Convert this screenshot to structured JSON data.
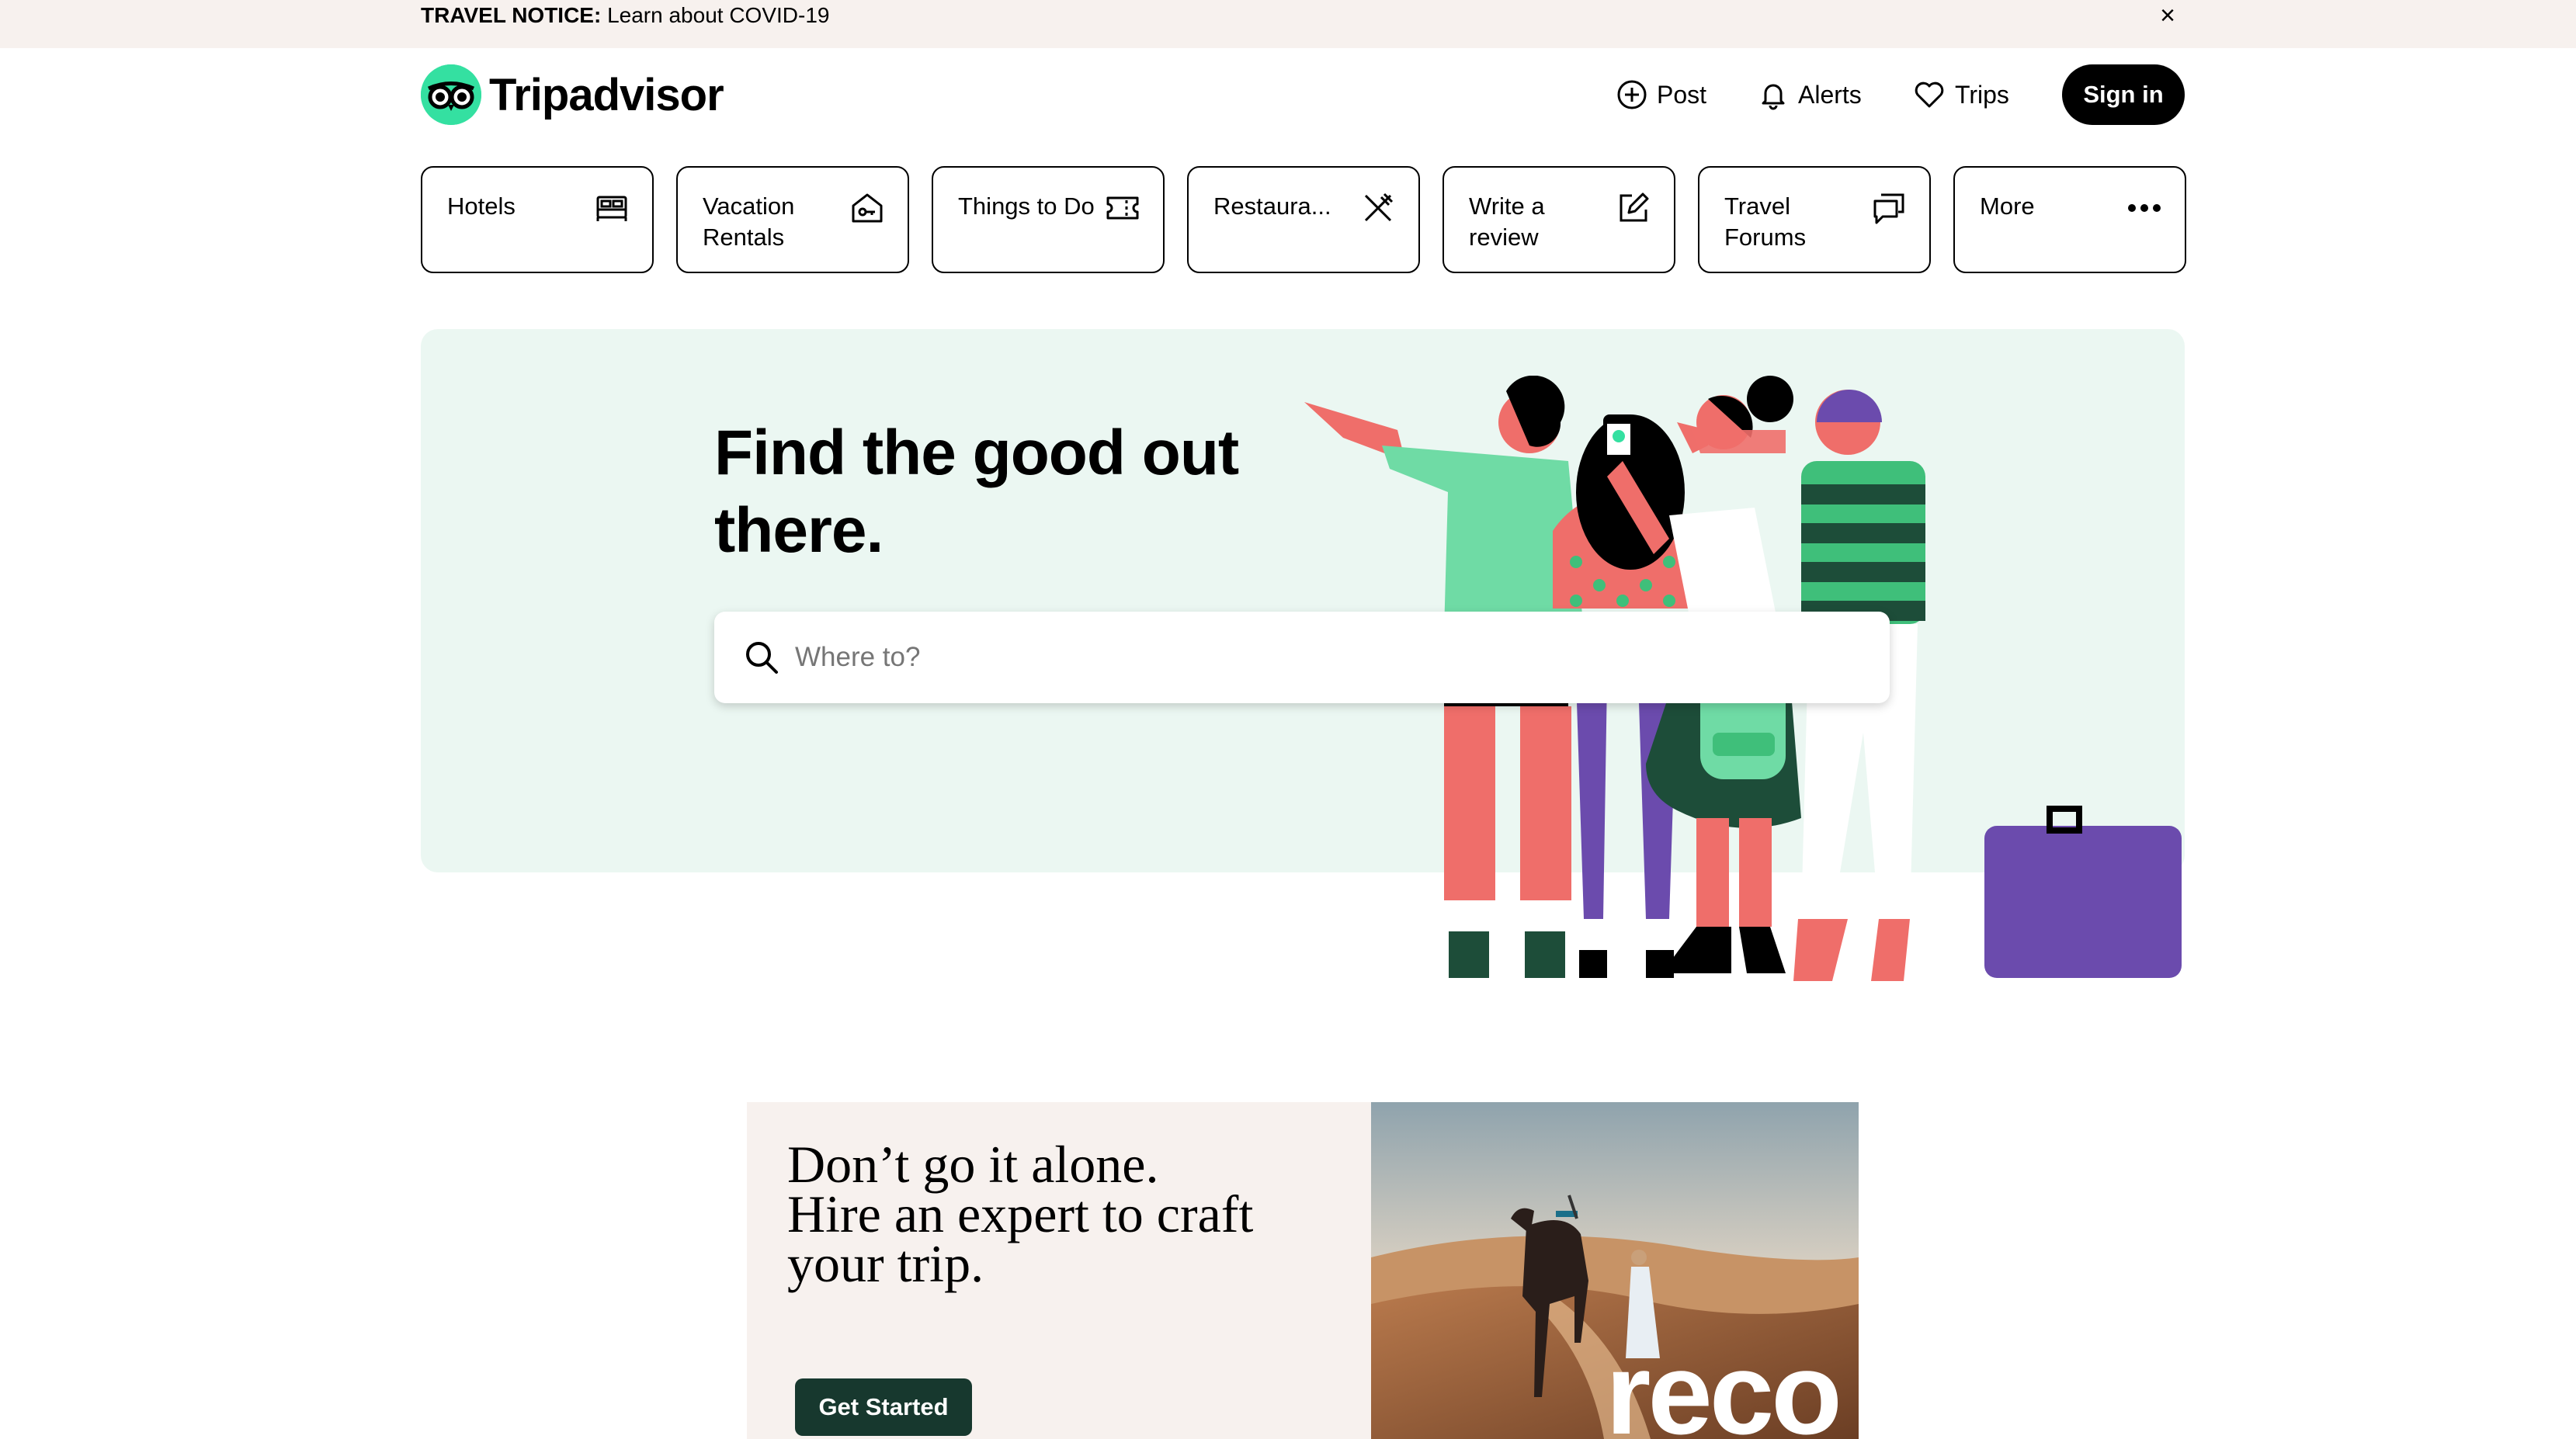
{
  "notice": {
    "label": "TRAVEL NOTICE:",
    "link": "Learn about COVID-19",
    "close_glyph": "×"
  },
  "header": {
    "logo_text": "Tripadvisor",
    "nav": [
      {
        "label": "Post",
        "icon": "plus-circle-icon"
      },
      {
        "label": "Alerts",
        "icon": "bell-icon"
      },
      {
        "label": "Trips",
        "icon": "heart-icon"
      }
    ],
    "signin_label": "Sign in"
  },
  "categories": [
    {
      "label": "Hotels",
      "icon": "bed-icon"
    },
    {
      "label": "Vacation Rentals",
      "icon": "house-key-icon"
    },
    {
      "label": "Things to Do",
      "icon": "ticket-icon"
    },
    {
      "label": "Restaura...",
      "icon": "utensils-icon"
    },
    {
      "label": "Write a review",
      "icon": "edit-icon"
    },
    {
      "label": "Travel Forums",
      "icon": "chat-bubbles-icon"
    },
    {
      "label": "More",
      "icon": "more-dots-icon"
    }
  ],
  "hero": {
    "title": "Find the good out there.",
    "search_placeholder": "Where to?"
  },
  "ad": {
    "headline_line1": "Don’t go it alone.",
    "headline_line2": "Hire an expert to craft",
    "headline_line3": "your trip.",
    "button_label": "Get Started",
    "brand_text": "reco"
  },
  "colors": {
    "brand_green": "#34e0a1",
    "hero_bg": "#ebf7f2",
    "notice_bg": "#f7f1ee",
    "ad_button": "#17382e"
  }
}
